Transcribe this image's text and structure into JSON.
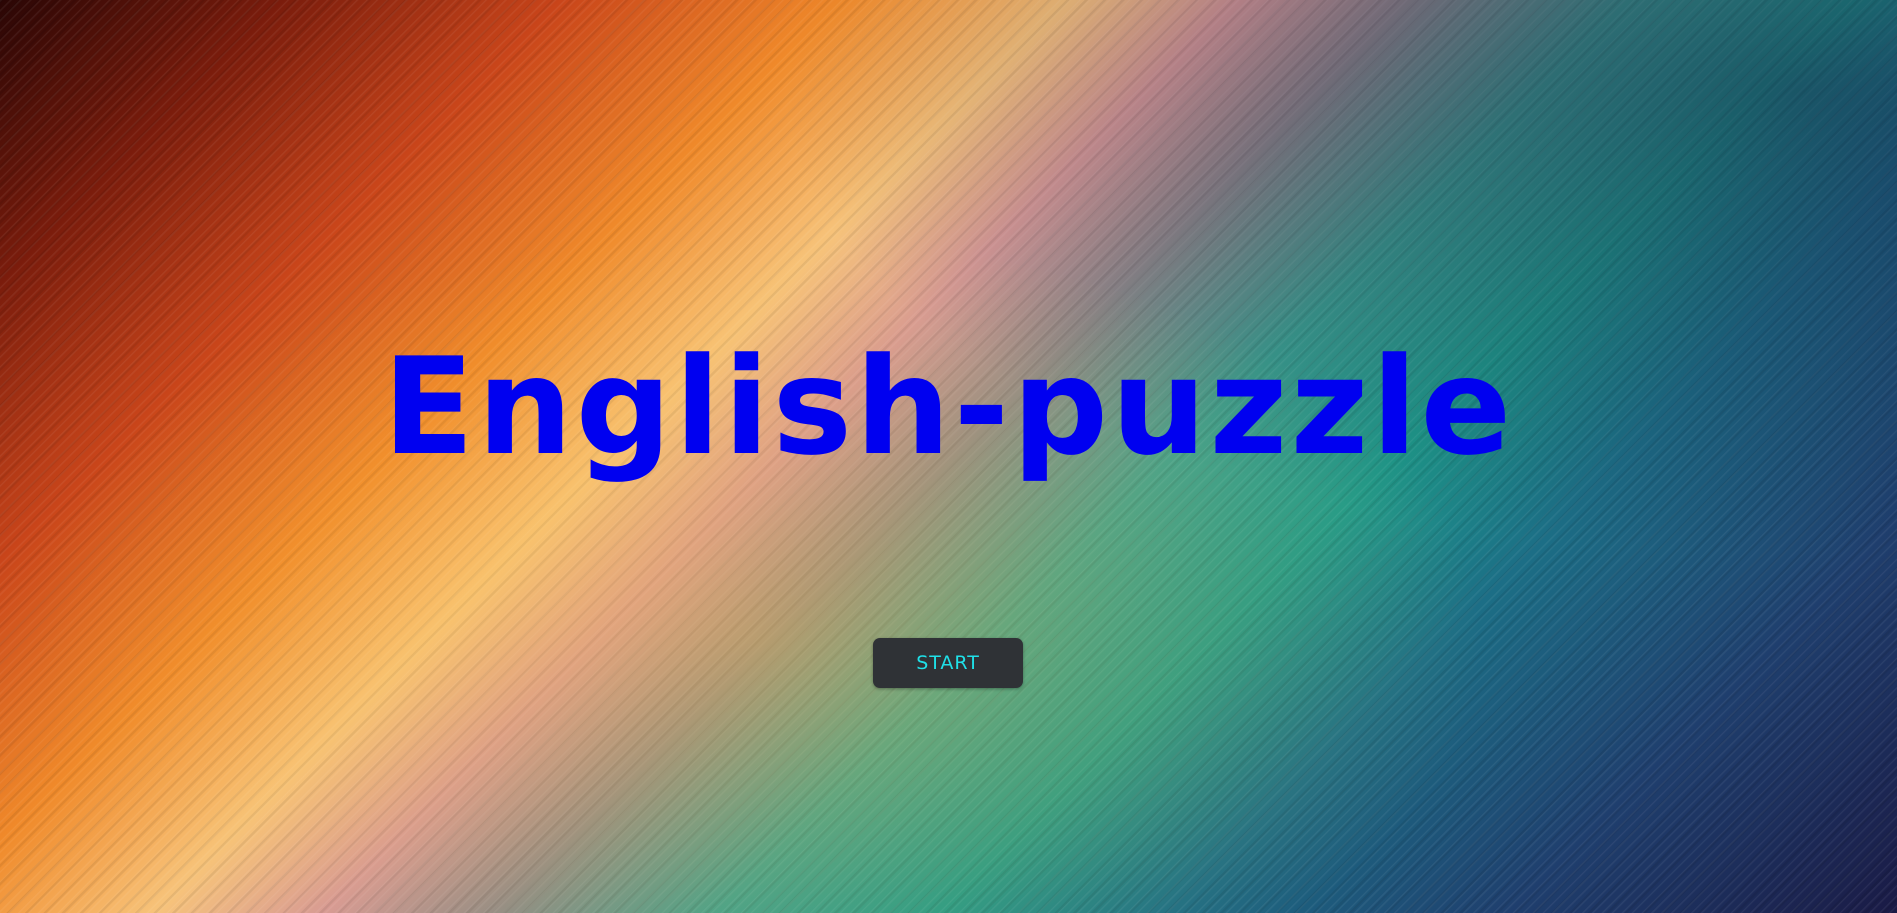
{
  "page": {
    "title": "English-puzzle",
    "title_color": "#0000f0"
  },
  "controls": {
    "start_label": "START",
    "start_bg": "#2f3236",
    "start_text_color": "#1fe0e8"
  },
  "background": {
    "description_colors": [
      "#2a0605",
      "#c9451a",
      "#f7c37a",
      "#3aa08f",
      "#1c6f86",
      "#1a1a45"
    ]
  }
}
